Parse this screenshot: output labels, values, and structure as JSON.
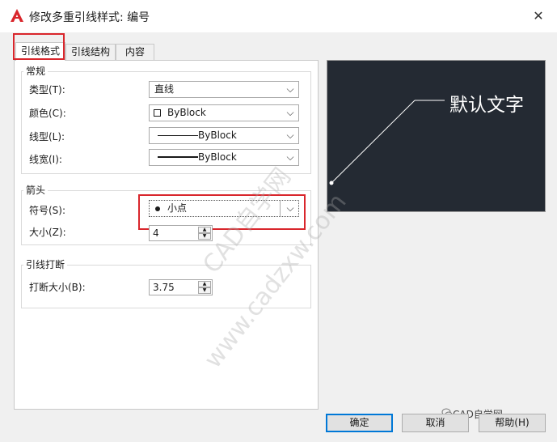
{
  "window": {
    "title": "修改多重引线样式: 编号",
    "close_symbol": "✕"
  },
  "tabs": [
    {
      "label": "引线格式",
      "active": true
    },
    {
      "label": "引线结构",
      "active": false
    },
    {
      "label": "内容",
      "active": false
    }
  ],
  "general": {
    "legend": "常规",
    "type": {
      "label": "类型(T):",
      "value": "直线"
    },
    "color": {
      "label": "颜色(C):",
      "value": "ByBlock"
    },
    "linetype": {
      "label": "线型(L):",
      "value": "ByBlock"
    },
    "lineweight": {
      "label": "线宽(I):",
      "value": "ByBlock"
    }
  },
  "arrowhead": {
    "legend": "箭头",
    "symbol": {
      "label": "符号(S):",
      "value": "小点"
    },
    "size": {
      "label": "大小(Z):",
      "value": "4"
    }
  },
  "leader_break": {
    "legend": "引线打断",
    "break_size": {
      "label": "打断大小(B):",
      "value": "3.75"
    }
  },
  "preview": {
    "text": "默认文字"
  },
  "buttons": {
    "ok": "确定",
    "cancel": "取消",
    "help": "帮助(H)"
  },
  "watermark": {
    "line1": "CAD自学网",
    "line2": "www.cadzxw.com",
    "credit": "CAD自学网"
  },
  "colors": {
    "highlight": "#d9262c",
    "preview_bg": "#242a33",
    "accent": "#0078d7",
    "logo": "#d9262c"
  }
}
